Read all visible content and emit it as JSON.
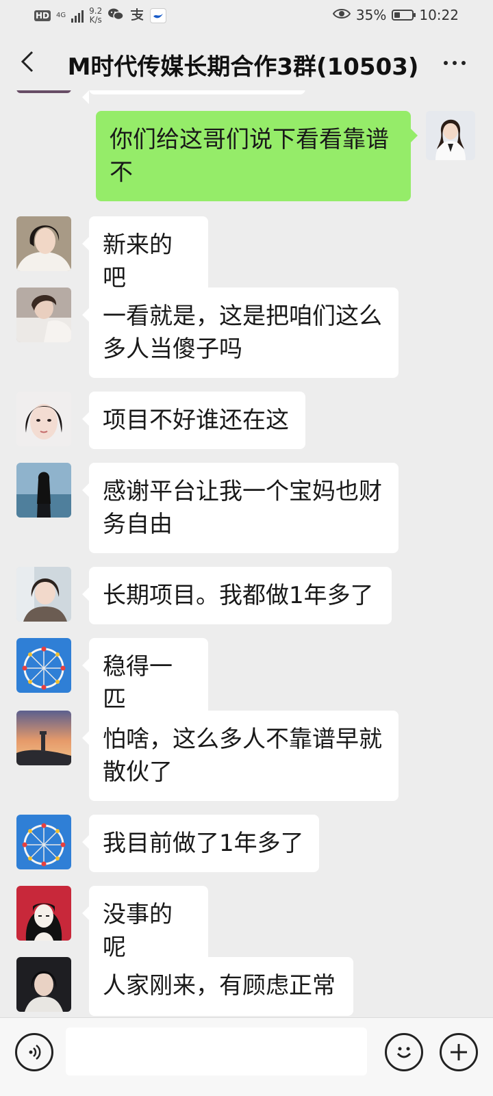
{
  "status_bar": {
    "hd": "HD",
    "network": "4G",
    "speed_value": "9.2",
    "speed_unit": "K/s",
    "battery_percent": "35%",
    "battery_level": 0.35,
    "time": "10:22",
    "icons": [
      "eye-icon",
      "wechat-icon",
      "alipay-icon",
      "bird-app-icon"
    ]
  },
  "header": {
    "title": "M时代传媒长期合作3群(10503)",
    "back_icon": "chevron-left-icon",
    "more_icon": "more-dots-icon"
  },
  "messages": [
    {
      "side": "right",
      "text": "你们给这哥们说下看看靠谱不",
      "avatar": "woman-portrait-avatar"
    },
    {
      "side": "left",
      "text": "新来的吧",
      "avatar": "girl-selfie-avatar"
    },
    {
      "side": "left",
      "text": "一看就是，这是把咱们这么多人当傻子吗",
      "avatar": "girl-lying-avatar"
    },
    {
      "side": "left",
      "text": "项目不好谁还在这",
      "avatar": "girl-closeup-avatar"
    },
    {
      "side": "left",
      "text": "感谢平台让我一个宝妈也财务自由",
      "avatar": "seaside-girl-avatar"
    },
    {
      "side": "left",
      "text": "长期项目。我都做1年多了",
      "avatar": "girl-smile-avatar"
    },
    {
      "side": "left",
      "text": "稳得一匹",
      "avatar": "ferris-wheel-avatar"
    },
    {
      "side": "left",
      "text": "怕啥，这么多人不靠谱早就散伙了",
      "avatar": "lighthouse-sunset-avatar"
    },
    {
      "side": "left",
      "text": "我目前做了1年多了",
      "avatar": "ferris-wheel-avatar"
    },
    {
      "side": "left",
      "text": "没事的呢",
      "avatar": "anime-girl-avatar"
    },
    {
      "side": "left",
      "text": "人家刚来，有顾虑正常",
      "avatar": "girl-dark-avatar"
    }
  ],
  "input_bar": {
    "voice_icon": "voice-icon",
    "emoji_icon": "emoji-icon",
    "plus_icon": "plus-icon",
    "value": ""
  }
}
